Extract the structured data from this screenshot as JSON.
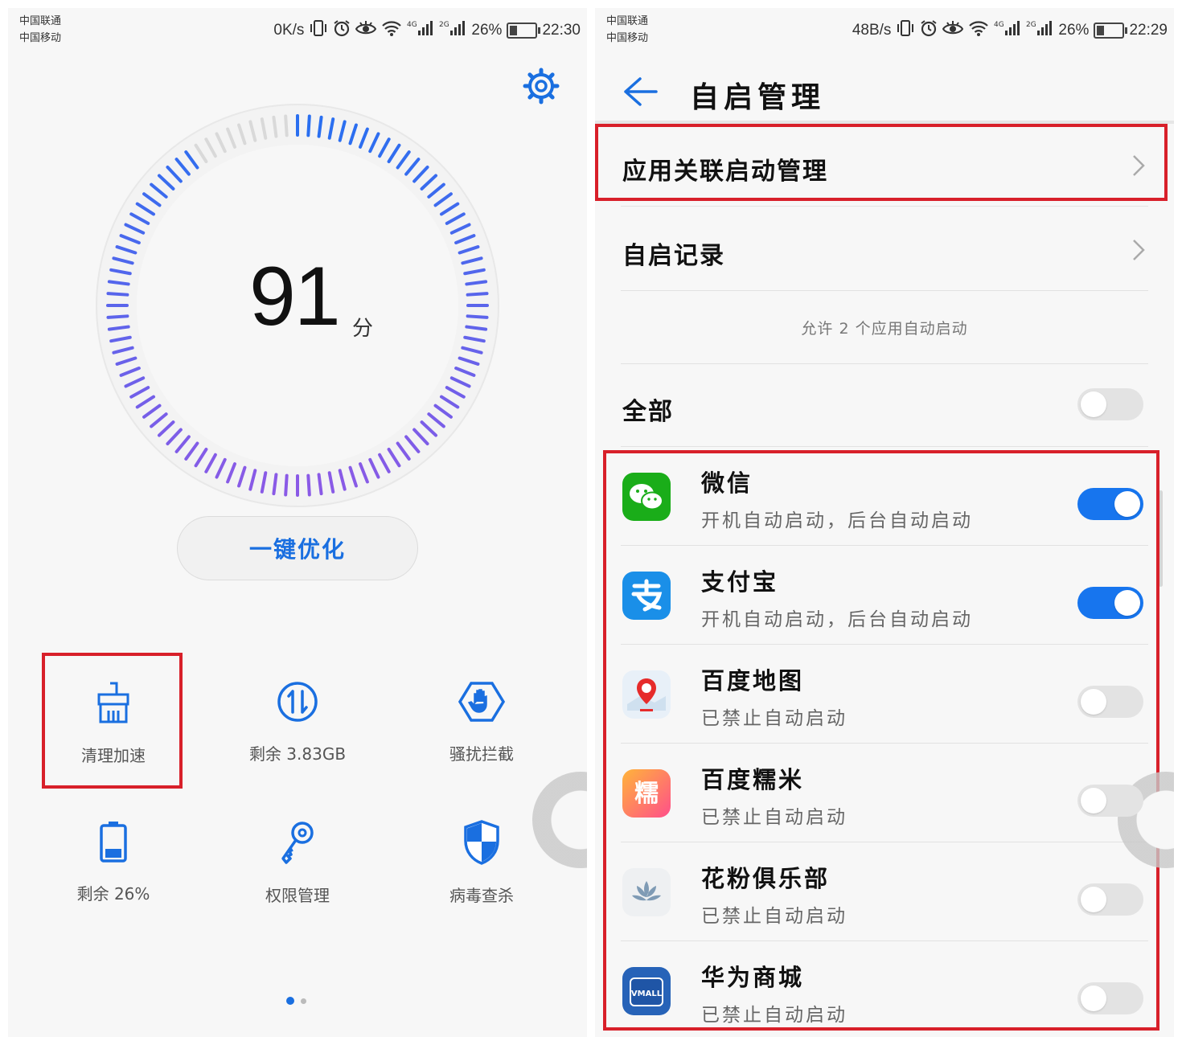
{
  "left": {
    "status": {
      "carrier1": "中国联通",
      "carrier2": "中国移动",
      "net_speed": "0K/s",
      "battery": "26%",
      "time": "22:30",
      "sig1": "4G",
      "sig2": "2G"
    },
    "score": {
      "value": "91",
      "unit": "分"
    },
    "optimize_label": "一键优化",
    "tools": [
      {
        "label": "清理加速",
        "icon": "broom-icon"
      },
      {
        "label": "剩余 3.83GB",
        "icon": "traffic-icon"
      },
      {
        "label": "骚扰拦截",
        "icon": "block-hand-icon"
      },
      {
        "label": "剩余 26%",
        "icon": "battery-icon"
      },
      {
        "label": "权限管理",
        "icon": "key-icon"
      },
      {
        "label": "病毒查杀",
        "icon": "shield-icon"
      }
    ],
    "page_index": 0,
    "page_count": 2
  },
  "right": {
    "status": {
      "carrier1": "中国联通",
      "carrier2": "中国移动",
      "net_speed": "48B/s",
      "battery": "26%",
      "time": "22:29",
      "sig1": "4G",
      "sig2": "2G"
    },
    "title": "自启管理",
    "menu": [
      {
        "label": "应用关联启动管理"
      },
      {
        "label": "自启记录"
      }
    ],
    "note": "允许 2 个应用自动启动",
    "all_label": "全部",
    "all_on": false,
    "apps": [
      {
        "name": "微信",
        "status": "开机自动启动，后台自动启动",
        "on": true,
        "icon": "wechat-icon",
        "color": "#1aad19"
      },
      {
        "name": "支付宝",
        "status": "开机自动启动，后台自动启动",
        "on": true,
        "icon": "alipay-icon",
        "color": "#1a8fe8"
      },
      {
        "name": "百度地图",
        "status": "已禁止自动启动",
        "on": false,
        "icon": "baidu-map-icon",
        "color": "#e8f0f8"
      },
      {
        "name": "百度糯米",
        "status": "已禁止自动启动",
        "on": false,
        "icon": "baidu-nuomi-icon",
        "color": "#ff5a7d",
        "glyph": "糯"
      },
      {
        "name": "花粉俱乐部",
        "status": "已禁止自动启动",
        "on": false,
        "icon": "huafen-club-icon",
        "color": "#eef0f2"
      },
      {
        "name": "华为商城",
        "status": "已禁止自动启动",
        "on": false,
        "icon": "vmall-icon",
        "color": "#2763b8",
        "glyph": "VMALL"
      }
    ],
    "accent": "#1775ee",
    "highlight_color": "#d8202a"
  }
}
